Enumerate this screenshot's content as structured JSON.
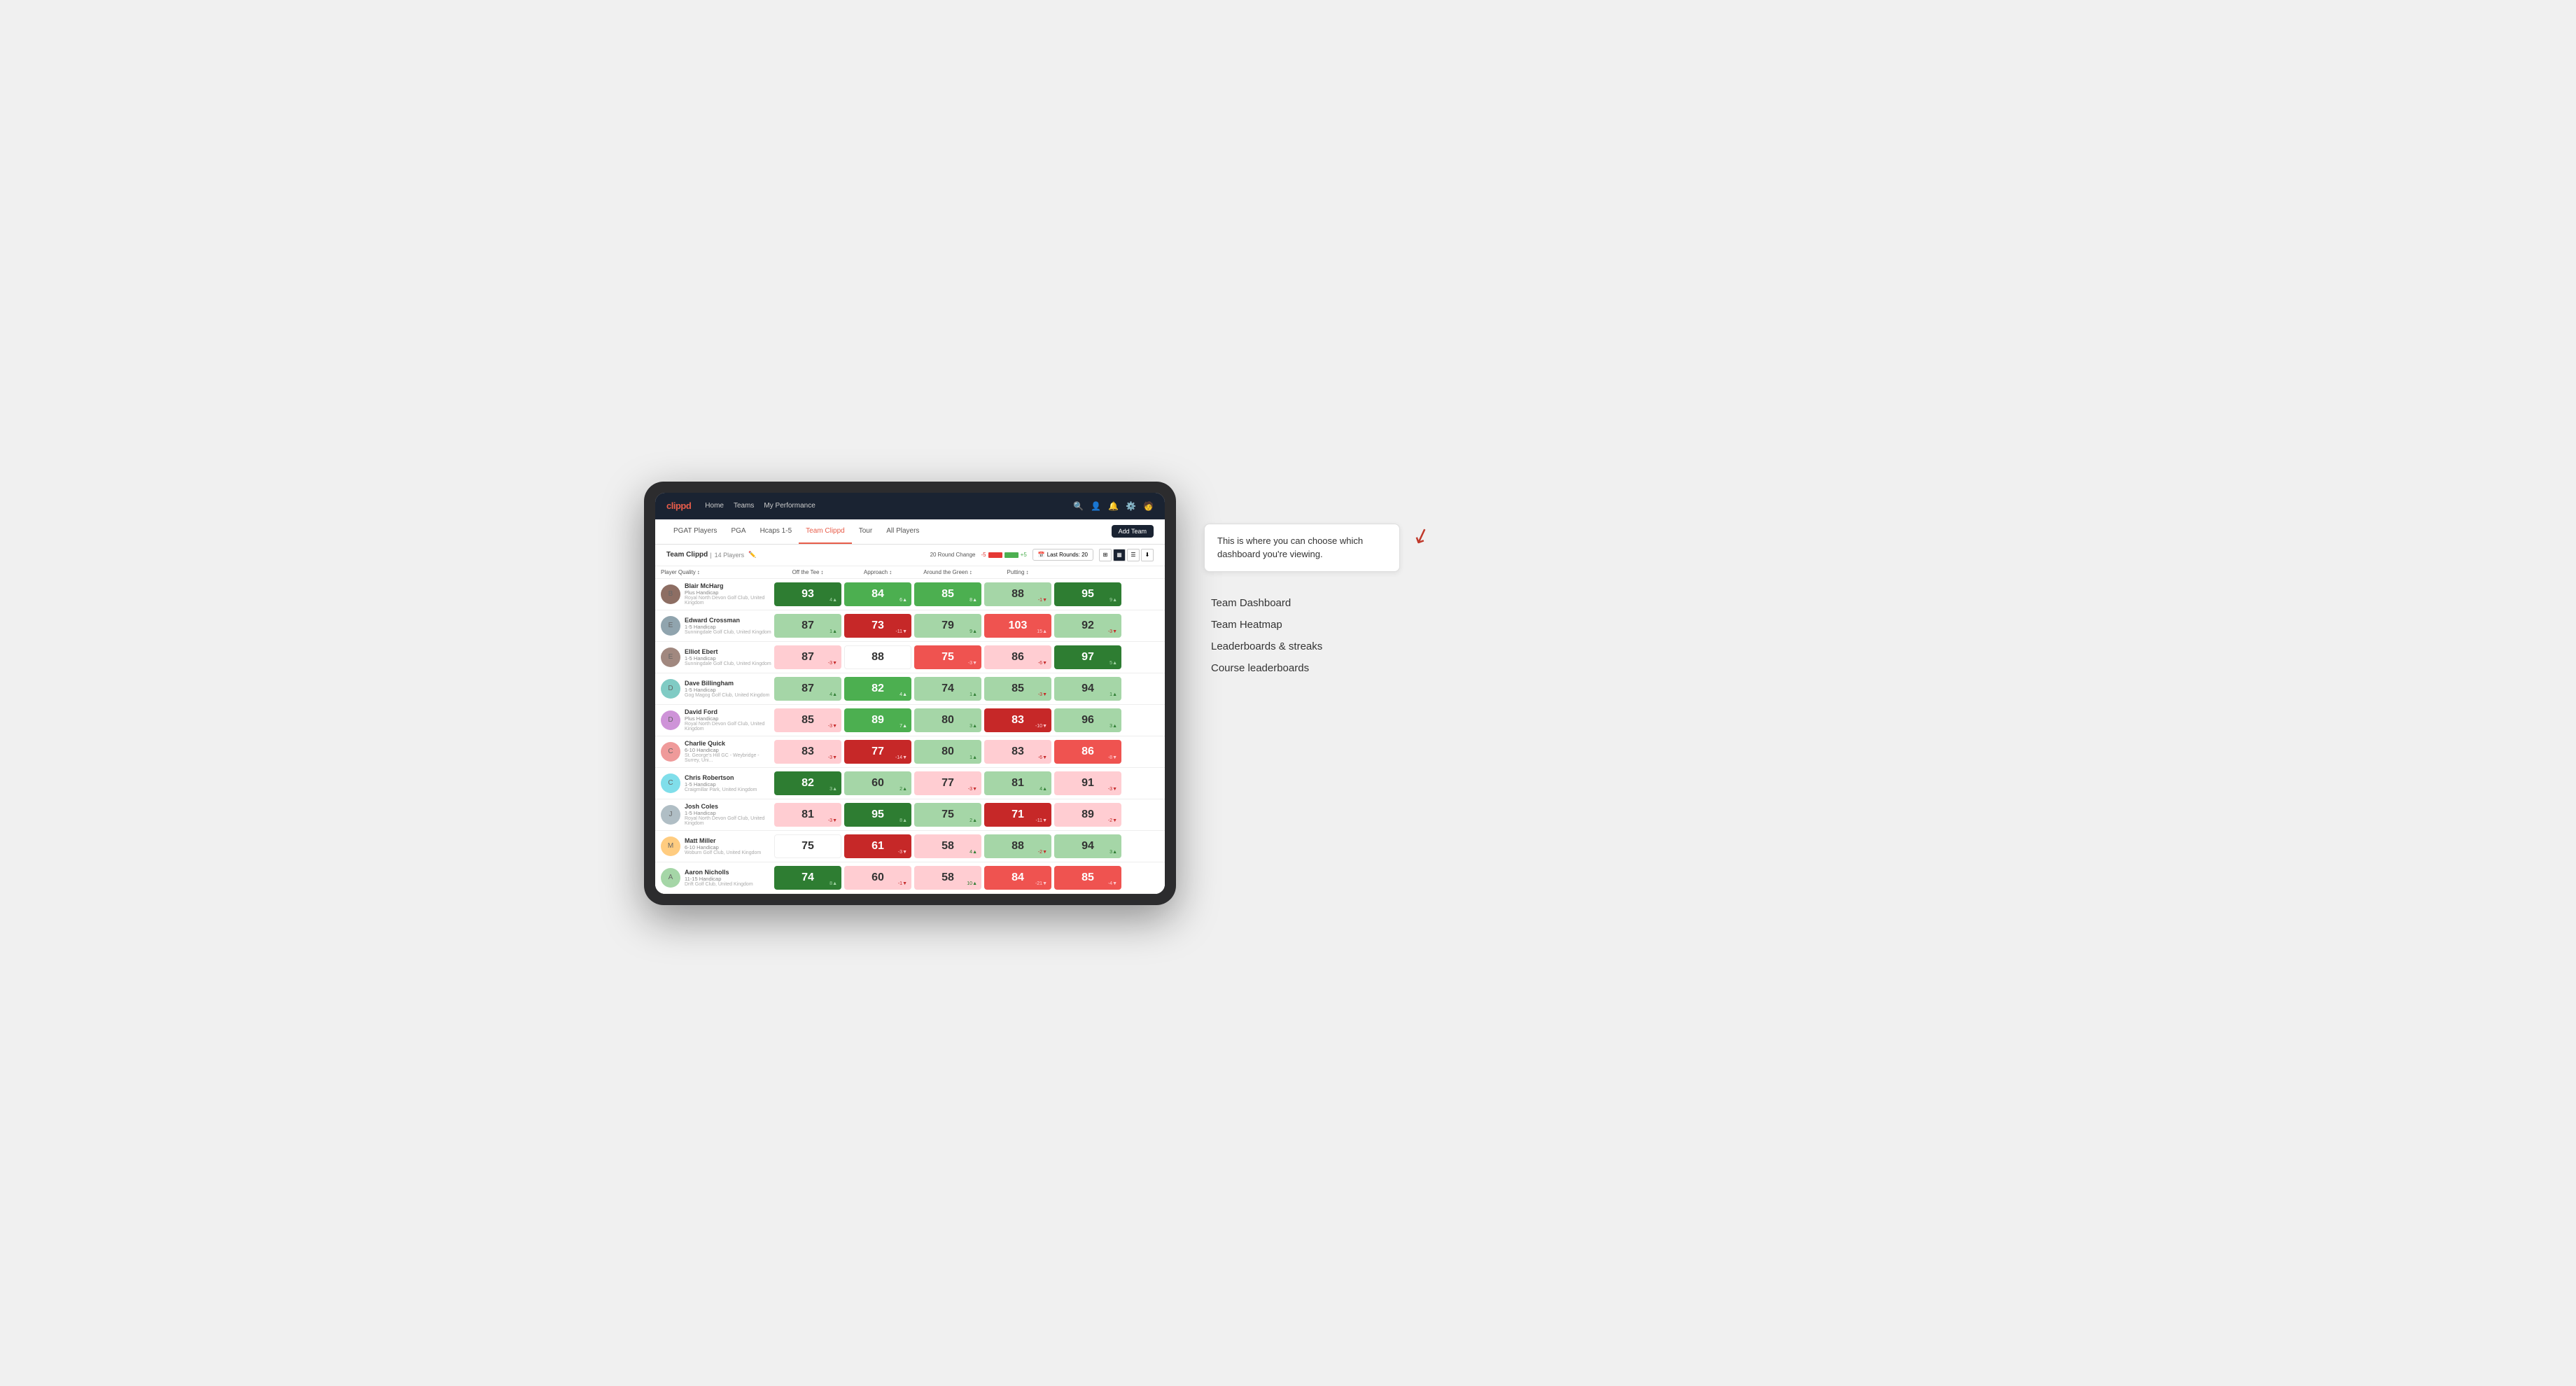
{
  "annotation": {
    "bubble_text": "This is where you can choose which dashboard you're viewing.",
    "items": [
      "Team Dashboard",
      "Team Heatmap",
      "Leaderboards & streaks",
      "Course leaderboards"
    ]
  },
  "nav": {
    "logo": "clippd",
    "links": [
      "Home",
      "Teams",
      "My Performance"
    ],
    "icons": [
      "search",
      "person",
      "bell",
      "settings",
      "avatar"
    ]
  },
  "tabs": [
    {
      "label": "PGAT Players",
      "active": false
    },
    {
      "label": "PGA",
      "active": false
    },
    {
      "label": "Hcaps 1-5",
      "active": false
    },
    {
      "label": "Team Clippd",
      "active": true
    },
    {
      "label": "Tour",
      "active": false
    },
    {
      "label": "All Players",
      "active": false
    }
  ],
  "add_team_label": "Add Team",
  "team": {
    "name": "Team Clippd",
    "player_count": "14 Players",
    "round_change_label": "20 Round Change",
    "change_neg": "-5",
    "change_pos": "+5",
    "last_rounds_label": "Last Rounds: 20"
  },
  "columns": [
    {
      "label": "Player Quality",
      "sort": true
    },
    {
      "label": "Off the Tee",
      "sort": true
    },
    {
      "label": "Approach",
      "sort": true
    },
    {
      "label": "Around the Green",
      "sort": true
    },
    {
      "label": "Putting",
      "sort": true
    }
  ],
  "players": [
    {
      "name": "Blair McHarg",
      "handicap": "Plus Handicap",
      "club": "Royal North Devon Golf Club, United Kingdom",
      "scores": [
        {
          "value": "93",
          "change": "4▲",
          "dir": "up",
          "bg": "bg-green-dark"
        },
        {
          "value": "84",
          "change": "6▲",
          "dir": "up",
          "bg": "bg-green-mid"
        },
        {
          "value": "85",
          "change": "8▲",
          "dir": "up",
          "bg": "bg-green-mid"
        },
        {
          "value": "88",
          "change": "-1▼",
          "dir": "down",
          "bg": "bg-green-light"
        },
        {
          "value": "95",
          "change": "9▲",
          "dir": "up",
          "bg": "bg-green-dark"
        }
      ]
    },
    {
      "name": "Edward Crossman",
      "handicap": "1-5 Handicap",
      "club": "Sunningdale Golf Club, United Kingdom",
      "scores": [
        {
          "value": "87",
          "change": "1▲",
          "dir": "up",
          "bg": "bg-green-light"
        },
        {
          "value": "73",
          "change": "-11▼",
          "dir": "down",
          "bg": "bg-red-dark"
        },
        {
          "value": "79",
          "change": "9▲",
          "dir": "up",
          "bg": "bg-green-light"
        },
        {
          "value": "103",
          "change": "15▲",
          "dir": "up",
          "bg": "bg-red-mid"
        },
        {
          "value": "92",
          "change": "-3▼",
          "dir": "down",
          "bg": "bg-green-light"
        }
      ]
    },
    {
      "name": "Elliot Ebert",
      "handicap": "1-5 Handicap",
      "club": "Sunningdale Golf Club, United Kingdom",
      "scores": [
        {
          "value": "87",
          "change": "-3▼",
          "dir": "down",
          "bg": "bg-red-light"
        },
        {
          "value": "88",
          "change": "",
          "dir": "neutral",
          "bg": "bg-white"
        },
        {
          "value": "75",
          "change": "-3▼",
          "dir": "down",
          "bg": "bg-red-mid"
        },
        {
          "value": "86",
          "change": "-6▼",
          "dir": "down",
          "bg": "bg-red-light"
        },
        {
          "value": "97",
          "change": "5▲",
          "dir": "up",
          "bg": "bg-green-dark"
        }
      ]
    },
    {
      "name": "Dave Billingham",
      "handicap": "1-5 Handicap",
      "club": "Gog Magog Golf Club, United Kingdom",
      "scores": [
        {
          "value": "87",
          "change": "4▲",
          "dir": "up",
          "bg": "bg-green-light"
        },
        {
          "value": "82",
          "change": "4▲",
          "dir": "up",
          "bg": "bg-green-mid"
        },
        {
          "value": "74",
          "change": "1▲",
          "dir": "up",
          "bg": "bg-green-light"
        },
        {
          "value": "85",
          "change": "-3▼",
          "dir": "down",
          "bg": "bg-green-light"
        },
        {
          "value": "94",
          "change": "1▲",
          "dir": "up",
          "bg": "bg-green-light"
        }
      ]
    },
    {
      "name": "David Ford",
      "handicap": "Plus Handicap",
      "club": "Royal North Devon Golf Club, United Kingdom",
      "scores": [
        {
          "value": "85",
          "change": "-3▼",
          "dir": "down",
          "bg": "bg-red-light"
        },
        {
          "value": "89",
          "change": "7▲",
          "dir": "up",
          "bg": "bg-green-mid"
        },
        {
          "value": "80",
          "change": "3▲",
          "dir": "up",
          "bg": "bg-green-light"
        },
        {
          "value": "83",
          "change": "-10▼",
          "dir": "down",
          "bg": "bg-red-dark"
        },
        {
          "value": "96",
          "change": "3▲",
          "dir": "up",
          "bg": "bg-green-light"
        }
      ]
    },
    {
      "name": "Charlie Quick",
      "handicap": "6-10 Handicap",
      "club": "St. George's Hill GC - Weybridge - Surrey, Uni...",
      "scores": [
        {
          "value": "83",
          "change": "-3▼",
          "dir": "down",
          "bg": "bg-red-light"
        },
        {
          "value": "77",
          "change": "-14▼",
          "dir": "down",
          "bg": "bg-red-dark"
        },
        {
          "value": "80",
          "change": "1▲",
          "dir": "up",
          "bg": "bg-green-light"
        },
        {
          "value": "83",
          "change": "-6▼",
          "dir": "down",
          "bg": "bg-red-light"
        },
        {
          "value": "86",
          "change": "-8▼",
          "dir": "down",
          "bg": "bg-red-mid"
        }
      ]
    },
    {
      "name": "Chris Robertson",
      "handicap": "1-5 Handicap",
      "club": "Craigmillar Park, United Kingdom",
      "scores": [
        {
          "value": "82",
          "change": "3▲",
          "dir": "up",
          "bg": "bg-green-dark"
        },
        {
          "value": "60",
          "change": "2▲",
          "dir": "up",
          "bg": "bg-green-light"
        },
        {
          "value": "77",
          "change": "-3▼",
          "dir": "down",
          "bg": "bg-red-light"
        },
        {
          "value": "81",
          "change": "4▲",
          "dir": "up",
          "bg": "bg-green-light"
        },
        {
          "value": "91",
          "change": "-3▼",
          "dir": "down",
          "bg": "bg-red-light"
        }
      ]
    },
    {
      "name": "Josh Coles",
      "handicap": "1-5 Handicap",
      "club": "Royal North Devon Golf Club, United Kingdom",
      "scores": [
        {
          "value": "81",
          "change": "-3▼",
          "dir": "down",
          "bg": "bg-red-light"
        },
        {
          "value": "95",
          "change": "8▲",
          "dir": "up",
          "bg": "bg-green-dark"
        },
        {
          "value": "75",
          "change": "2▲",
          "dir": "up",
          "bg": "bg-green-light"
        },
        {
          "value": "71",
          "change": "-11▼",
          "dir": "down",
          "bg": "bg-red-dark"
        },
        {
          "value": "89",
          "change": "-2▼",
          "dir": "down",
          "bg": "bg-red-light"
        }
      ]
    },
    {
      "name": "Matt Miller",
      "handicap": "6-10 Handicap",
      "club": "Woburn Golf Club, United Kingdom",
      "scores": [
        {
          "value": "75",
          "change": "",
          "dir": "neutral",
          "bg": "bg-white"
        },
        {
          "value": "61",
          "change": "-3▼",
          "dir": "down",
          "bg": "bg-red-dark"
        },
        {
          "value": "58",
          "change": "4▲",
          "dir": "up",
          "bg": "bg-red-light"
        },
        {
          "value": "88",
          "change": "-2▼",
          "dir": "down",
          "bg": "bg-green-light"
        },
        {
          "value": "94",
          "change": "3▲",
          "dir": "up",
          "bg": "bg-green-light"
        }
      ]
    },
    {
      "name": "Aaron Nicholls",
      "handicap": "11-15 Handicap",
      "club": "Drift Golf Club, United Kingdom",
      "scores": [
        {
          "value": "74",
          "change": "8▲",
          "dir": "up",
          "bg": "bg-green-dark"
        },
        {
          "value": "60",
          "change": "-1▼",
          "dir": "down",
          "bg": "bg-red-light"
        },
        {
          "value": "58",
          "change": "10▲",
          "dir": "up",
          "bg": "bg-red-light"
        },
        {
          "value": "84",
          "change": "-21▼",
          "dir": "down",
          "bg": "bg-red-mid"
        },
        {
          "value": "85",
          "change": "-4▼",
          "dir": "down",
          "bg": "bg-red-mid"
        }
      ]
    }
  ]
}
